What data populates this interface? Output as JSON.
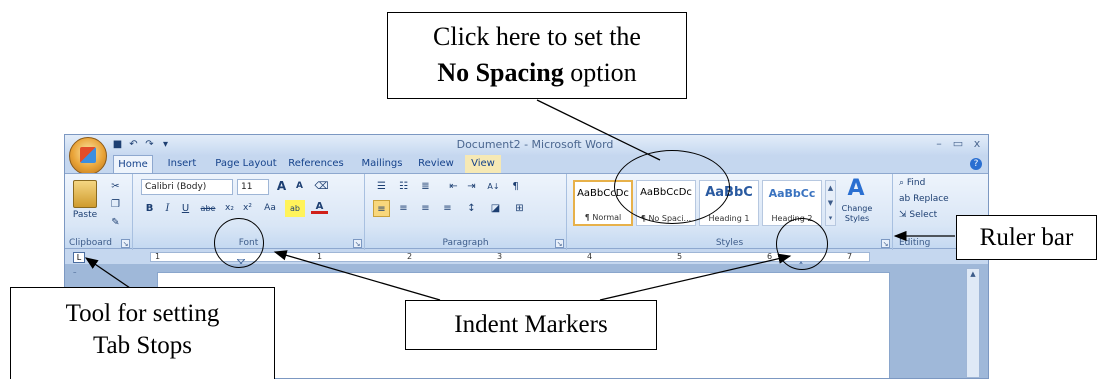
{
  "callouts": {
    "no_spacing_line1": "Click here to set the",
    "no_spacing_bold": "No Spacing",
    "no_spacing_rest": " option",
    "ruler_bar": "Ruler bar",
    "tab_stops_line1": "Tool for setting",
    "tab_stops_line2": "Tab Stops",
    "indent_markers": "Indent Markers"
  },
  "window": {
    "title": "Document2 - Microsoft Word",
    "minimize": "–",
    "restore": "▭",
    "close": "x",
    "help": "?"
  },
  "tabs": [
    {
      "label": "Home",
      "active": true
    },
    {
      "label": "Insert"
    },
    {
      "label": "Page Layout"
    },
    {
      "label": "References"
    },
    {
      "label": "Mailings"
    },
    {
      "label": "Review"
    },
    {
      "label": "View"
    }
  ],
  "clipboard": {
    "paste_label": "Paste",
    "group_label": "Clipboard"
  },
  "font": {
    "font_name": "Calibri (Body)",
    "font_size": "11",
    "group_label": "Font",
    "bold": "B",
    "italic": "I",
    "underline": "U",
    "strike": "abe",
    "subscript": "x₂",
    "superscript": "x²",
    "change_case": "Aa",
    "grow": "A",
    "shrink": "A",
    "highlight": "ab",
    "font_color": "A"
  },
  "paragraph": {
    "group_label": "Paragraph",
    "show_marks": "¶",
    "sort": "A↓"
  },
  "styles": {
    "group_label": "Styles",
    "items": [
      {
        "sample": "AaBbCcDc",
        "name": "¶ Normal"
      },
      {
        "sample": "AaBbCcDc",
        "name": "¶ No Spaci..."
      },
      {
        "sample": "AaBbC",
        "name": "Heading 1"
      },
      {
        "sample": "AaBbCc",
        "name": "Heading 2"
      }
    ],
    "change_styles_line1": "Change",
    "change_styles_line2": "Styles"
  },
  "editing": {
    "find": "Find",
    "replace": "Replace",
    "select": "Select",
    "group_label": "Editing"
  },
  "ruler": {
    "tab_selector": "L",
    "numbers": [
      "1",
      "1",
      "2",
      "3",
      "4",
      "5",
      "6",
      "7"
    ]
  },
  "colors": {
    "ribbon_accent": "#15428b",
    "selected_style_border": "#e7b14a"
  }
}
